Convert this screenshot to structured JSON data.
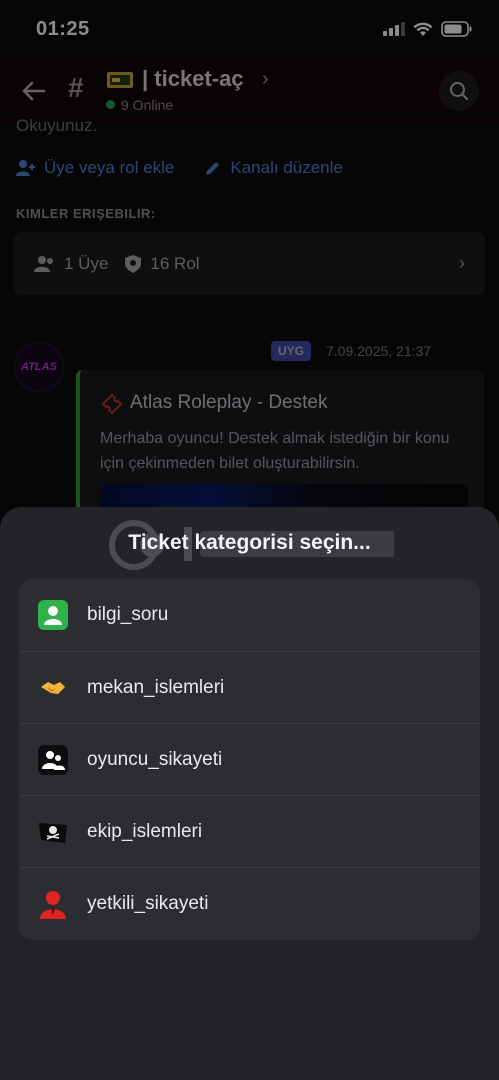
{
  "status_bar": {
    "time": "01:25"
  },
  "header": {
    "title": "| ticket-aç",
    "online": "9 Online"
  },
  "background": {
    "cut_text": "Okuyunuz.",
    "add_member_label": "Üye veya rol ekle",
    "edit_channel_label": "Kanalı düzenle",
    "access_label": "KIMLER ERIŞEBILIR:",
    "members": "1 Üye",
    "roles": "16 Rol",
    "avatar_text": "ATLAS",
    "app_badge": "UYG",
    "message_time": "7.09.2025, 21:37",
    "embed_title": "Atlas Roleplay - Destek",
    "embed_desc": "Merhaba oyuncu! Destek almak istediğin bir konu için çekinmeden bilet oluşturabilirsin."
  },
  "sheet": {
    "title": "Ticket kategorisi seçin...",
    "options": [
      {
        "label": "bilgi_soru",
        "icon": "green-user-icon"
      },
      {
        "label": "mekan_islemleri",
        "icon": "handshake-icon"
      },
      {
        "label": "oyuncu_sikayeti",
        "icon": "people-icon"
      },
      {
        "label": "ekip_islemleri",
        "icon": "pirate-flag-icon"
      },
      {
        "label": "yetkili_sikayeti",
        "icon": "red-user-icon"
      }
    ]
  },
  "colors": {
    "accent_blue": "#4e82d6",
    "online_green": "#23a55a",
    "embed_bar": "#2a9b2a",
    "sheet_bg": "#232428",
    "list_bg": "#2b2d31"
  }
}
